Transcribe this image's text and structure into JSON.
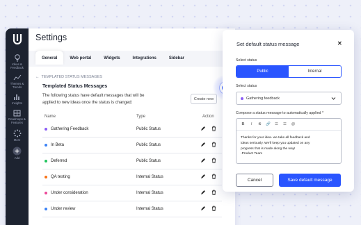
{
  "app": {
    "title": "Settings"
  },
  "sidebar": {
    "items": [
      {
        "label": "Ideas &\nFeedback",
        "icon": "lightbulb-icon"
      },
      {
        "label": "Themes &\nTrends",
        "icon": "trend-icon"
      },
      {
        "label": "Insights",
        "icon": "bar-chart-icon"
      },
      {
        "label": "Roadmaps &\nFeatures",
        "icon": "roadmap-icon"
      },
      {
        "label": "More",
        "icon": "more-dots-icon"
      },
      {
        "label": "Add",
        "icon": "add-icon"
      }
    ]
  },
  "tabs": [
    "General",
    "Web portal",
    "Widgets",
    "Integrations",
    "Sidebar"
  ],
  "active_tab": "General",
  "breadcrumb": {
    "back_label": "TEMPLATED STATUS MESSAGES"
  },
  "section": {
    "title": "Templated Status Messages",
    "description": "The following status have default messages that will be applied to new ideas once the status is changed:",
    "create_button": "Create new"
  },
  "table": {
    "columns": [
      "Name",
      "Type",
      "Action"
    ],
    "rows": [
      {
        "name": "Gathering Feedback",
        "type": "Public Status",
        "color": "#8b5cf6"
      },
      {
        "name": "In Beta",
        "type": "Public Status",
        "color": "#3b82f6"
      },
      {
        "name": "Deferred",
        "type": "Public Status",
        "color": "#22c55e"
      },
      {
        "name": "QA testing",
        "type": "Internal Status",
        "color": "#f97316"
      },
      {
        "name": "Under consideration",
        "type": "Internal Status",
        "color": "#ec4899"
      },
      {
        "name": "Under review",
        "type": "Internal Status",
        "color": "#3b82f6"
      }
    ]
  },
  "modal": {
    "title": "Set default status message",
    "select_status_label": "Select status",
    "status_options": [
      "Public",
      "Internal"
    ],
    "selected_option": "Public",
    "select_status_label2": "Select status",
    "selected_status": "Gathering feedback",
    "compose_label": "Compose a status message to automatically applied *",
    "toolbar": [
      "B",
      "I",
      "S",
      "🔗",
      "☰",
      "☰",
      "@"
    ],
    "message": "Thanks for your idea- we take all feedback and\nideas seriously. We'll keep you updated on any\nprogress that is made along the way!\n-Product Team",
    "cancel_label": "Cancel",
    "save_label": "Save default message"
  },
  "colors": {
    "accent": "#2a55ff",
    "sidebar": "#1d2330"
  }
}
